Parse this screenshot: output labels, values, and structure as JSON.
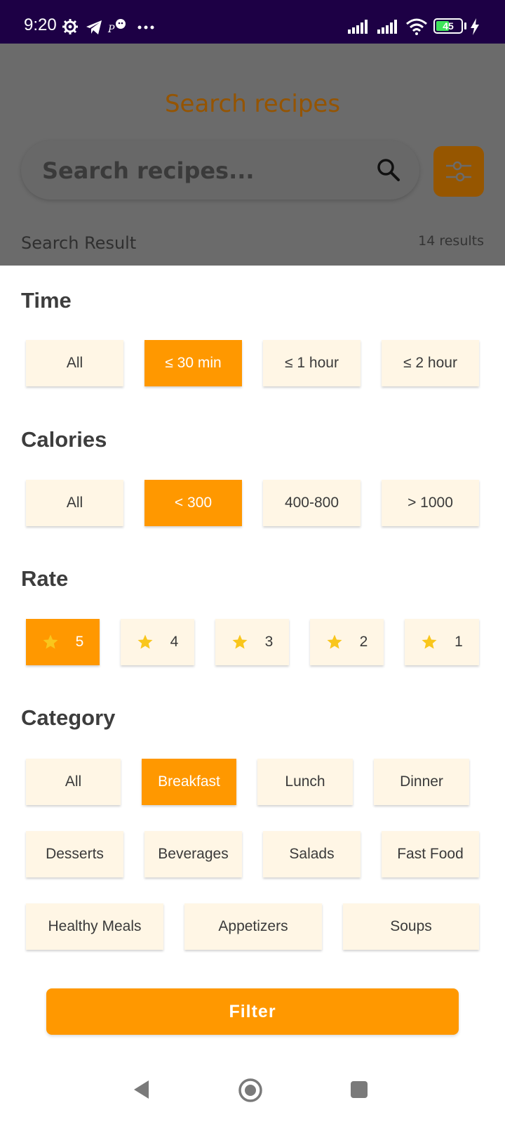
{
  "status_bar": {
    "time": "9:20",
    "battery": "45",
    "icons": [
      "gear-icon",
      "telegram-icon",
      "app-notification-icon",
      "more-icon",
      "signal-icon",
      "signal-icon",
      "wifi-icon",
      "battery-icon",
      "charging-icon"
    ]
  },
  "background": {
    "title": "Search recipes",
    "search_placeholder": "Search recipes...",
    "result_label": "Search Result",
    "result_count": "14 results"
  },
  "filters": {
    "time": {
      "title": "Time",
      "options": [
        "All",
        "≤ 30 min",
        "≤ 1 hour",
        "≤ 2 hour"
      ],
      "selected": "≤ 30 min"
    },
    "calories": {
      "title": "Calories",
      "options": [
        "All",
        "< 300",
        "400-800",
        "> 1000"
      ],
      "selected": "< 300"
    },
    "rate": {
      "title": "Rate",
      "options": [
        "5",
        "4",
        "3",
        "2",
        "1"
      ],
      "selected": "5"
    },
    "category": {
      "title": "Category",
      "options": [
        "All",
        "Breakfast",
        "Lunch",
        "Dinner",
        "Desserts",
        "Beverages",
        "Salads",
        "Fast Food",
        "Healthy Meals",
        "Appetizers",
        "Soups"
      ],
      "selected": "Breakfast"
    }
  },
  "filter_button": "Filter",
  "colors": {
    "accent": "#ff9800",
    "chip_bg": "#fff6e5",
    "star": "#f9c61c",
    "status_bar": "#1d0045"
  }
}
